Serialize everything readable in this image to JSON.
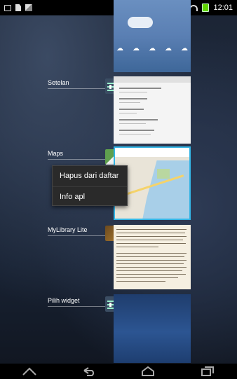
{
  "status_bar": {
    "time": "12:01",
    "icons": [
      "tablet-icon",
      "document-icon",
      "image-icon",
      "mute-icon",
      "wifi-icon",
      "battery-icon"
    ],
    "battery_color": "#5fd400"
  },
  "recent_apps": [
    {
      "label": "",
      "card": "weather"
    },
    {
      "label": "Setelan",
      "card": "settings",
      "icon": "settings-icon"
    },
    {
      "label": "Maps",
      "card": "maps",
      "icon": "maps-icon"
    },
    {
      "label": "MyLibrary Lite",
      "card": "library",
      "icon": "book-icon"
    },
    {
      "label": "Pilih widget",
      "card": "widget",
      "icon": "settings-icon"
    }
  ],
  "context_menu": {
    "items": [
      {
        "label": "Hapus dari daftar"
      },
      {
        "label": "Info apl"
      }
    ]
  },
  "nav_bar": {
    "buttons": [
      "recents-icon",
      "back-icon",
      "home-icon",
      "overview-icon"
    ]
  },
  "colors": {
    "accent": "#33b5e5",
    "menu_bg": "#2a2a2a"
  }
}
